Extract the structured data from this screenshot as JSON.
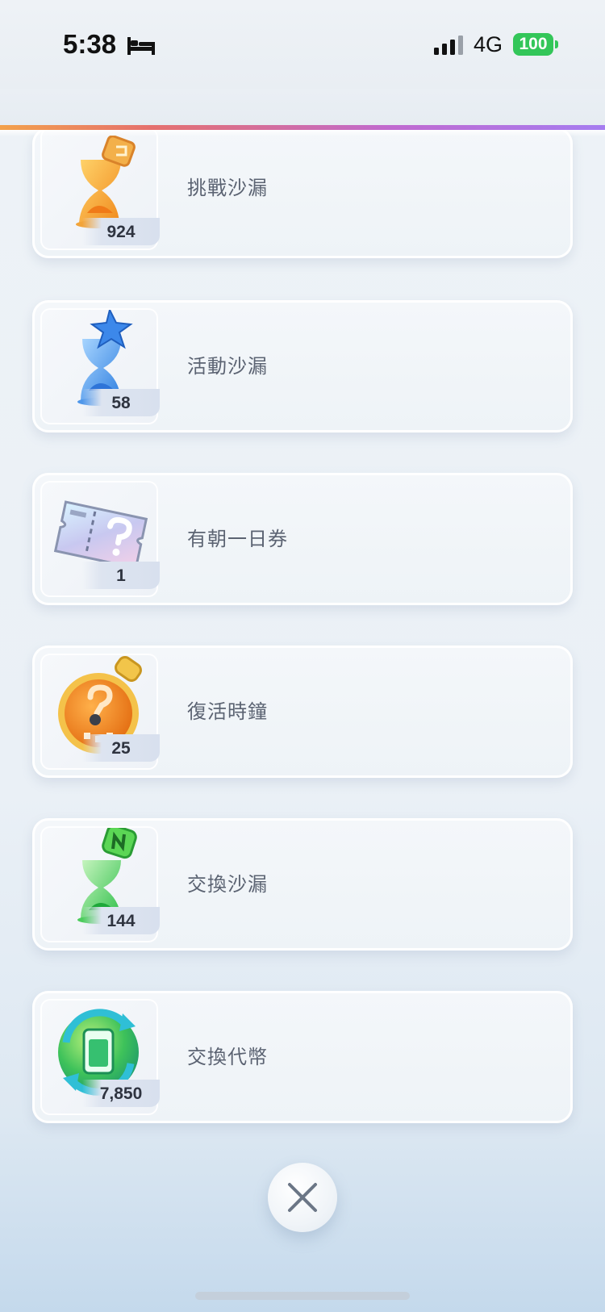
{
  "status_bar": {
    "time": "5:38",
    "network": "4G",
    "battery": "100",
    "icons": [
      "bed-icon",
      "signal-icon",
      "battery-icon"
    ]
  },
  "items": [
    {
      "name": "挑戰沙漏",
      "count": "924",
      "icon": "orange-hourglass-icon"
    },
    {
      "name": "活動沙漏",
      "count": "58",
      "icon": "blue-hourglass-icon"
    },
    {
      "name": "有朝一日券",
      "count": "1",
      "icon": "question-ticket-icon"
    },
    {
      "name": "復活時鐘",
      "count": "25",
      "icon": "stopwatch-icon"
    },
    {
      "name": "交換沙漏",
      "count": "144",
      "icon": "green-hourglass-icon"
    },
    {
      "name": "交換代幣",
      "count": "7,850",
      "icon": "exchange-token-icon"
    }
  ],
  "controls": {
    "close_icon": "close-icon"
  },
  "colors": {
    "accent_gradient": [
      "#f3a14b",
      "#e5706e",
      "#c06ad0",
      "#a67df0"
    ],
    "battery": "#33c659",
    "label_text": "#5b6372"
  }
}
